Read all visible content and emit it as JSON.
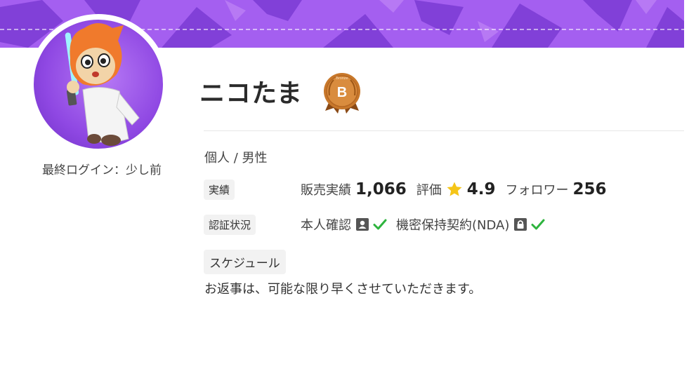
{
  "profile": {
    "username": "ニコたま",
    "rank_letter": "B",
    "rank_ribbon": "Bronze",
    "last_login": "最終ログイン：少し前",
    "type_gender": "個人 /  男性"
  },
  "stats": {
    "label": "実績",
    "sales_label": "販売実績",
    "sales_value": "1,066",
    "rating_label": "評価",
    "rating_value": "4.9",
    "followers_label": "フォロワー",
    "followers_value": "256"
  },
  "verification": {
    "label": "認証状況",
    "identity_label": "本人確認",
    "nda_label": "機密保持契約(NDA)"
  },
  "schedule": {
    "label": "スケジュール",
    "text": "お返事は、可能な限り早くさせていただきます。"
  },
  "icons": {
    "rating": "star-icon",
    "identity": "id-card-icon",
    "nda": "lock-icon",
    "verified": "check-icon"
  },
  "colors": {
    "cover": "#a45ff0",
    "star": "#f5c518",
    "check": "#2eb43e",
    "badge": "#c8782b",
    "avatar_bg": "#8f48e3"
  }
}
